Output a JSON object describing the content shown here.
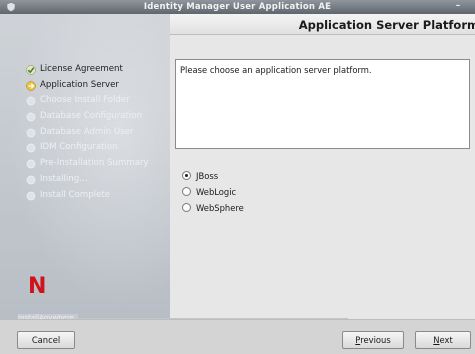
{
  "window": {
    "title": "Identity Manager User Application AE",
    "minimize_glyph": "–"
  },
  "page": {
    "title": "Application Server Platform"
  },
  "steps": [
    {
      "label": "License Agreement",
      "state": "done",
      "icon": "checkmark-icon"
    },
    {
      "label": "Application Server",
      "state": "current",
      "icon": "arrow-right-icon"
    },
    {
      "label": "Choose Install Folder",
      "state": "pending",
      "icon": "circle-icon"
    },
    {
      "label": "Database Configuration",
      "state": "pending",
      "icon": "circle-icon"
    },
    {
      "label": "Database Admin User",
      "state": "pending",
      "icon": "circle-icon"
    },
    {
      "label": "IDM Configuration",
      "state": "pending",
      "icon": "circle-icon"
    },
    {
      "label": "Pre-Installation Summary",
      "state": "pending",
      "icon": "circle-icon"
    },
    {
      "label": "Installing...",
      "state": "pending",
      "icon": "circle-icon"
    },
    {
      "label": "Install Complete",
      "state": "pending",
      "icon": "circle-icon"
    }
  ],
  "logo": {
    "text": "N",
    "color": "#d0121b"
  },
  "brand": {
    "text": "InstallAnywhere"
  },
  "description": "Please choose an application server platform.",
  "platforms": [
    {
      "label": "JBoss",
      "checked": true
    },
    {
      "label": "WebLogic",
      "checked": false
    },
    {
      "label": "WebSphere",
      "checked": false
    }
  ],
  "buttons": {
    "cancel": "Cancel",
    "previous": {
      "mnemonic": "P",
      "rest": "revious"
    },
    "next": {
      "mnemonic": "N",
      "rest": "ext"
    }
  }
}
